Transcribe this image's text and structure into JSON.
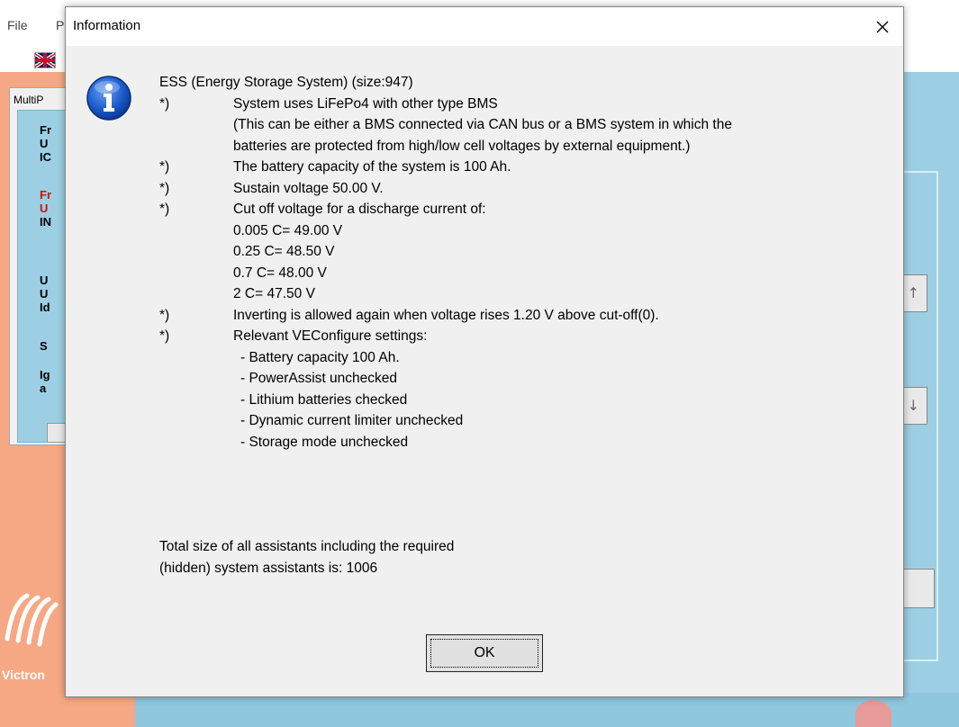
{
  "app": {
    "menu": {
      "file": "File",
      "second_partial": "P"
    },
    "multi_panel_title": "MultiP",
    "status_lines": [
      {
        "text": "Fr",
        "color": "#000000"
      },
      {
        "text": "U",
        "color": "#000000"
      },
      {
        "text": "IC",
        "color": "#000000"
      },
      {
        "text": "Fr",
        "color": "#d01010"
      },
      {
        "text": "U",
        "color": "#d01010"
      },
      {
        "text": "IN",
        "color": "#000000"
      },
      {
        "text": "U",
        "color": "#000000"
      },
      {
        "text": "U",
        "color": "#000000"
      },
      {
        "text": "Id",
        "color": "#000000"
      },
      {
        "text": "S",
        "color": "#000000"
      },
      {
        "text": "Ig",
        "color": "#000000"
      },
      {
        "text": "a",
        "color": "#000000"
      }
    ],
    "logo_text": "Victron",
    "colors": {
      "background_orange": "#f6a884",
      "panel_blue": "#9ccfe3"
    }
  },
  "dialog": {
    "title": "Information",
    "icon": "info-icon",
    "close_icon": "close-icon",
    "heading": "ESS (Energy Storage System) (size:947)",
    "lines": [
      {
        "bullet": "*)",
        "text": "System uses LiFePo4 with other type BMS"
      },
      {
        "bullet": "",
        "text": "(This can be either a BMS connected via CAN bus or a BMS system in which the"
      },
      {
        "bullet": "",
        "text": "batteries are protected from high/low cell voltages by external equipment.)"
      },
      {
        "bullet": "*)",
        "text": "The battery capacity of the system is 100 Ah."
      },
      {
        "bullet": "*)",
        "text": "Sustain voltage 50.00 V."
      },
      {
        "bullet": "*)",
        "text": "Cut off voltage for a discharge current of:"
      },
      {
        "bullet": "",
        "text": "0.005 C= 49.00 V"
      },
      {
        "bullet": "",
        "text": "0.25 C= 48.50 V"
      },
      {
        "bullet": "",
        "text": "0.7 C= 48.00 V"
      },
      {
        "bullet": "",
        "text": "2 C= 47.50 V"
      },
      {
        "bullet": "*)",
        "text": "Inverting is allowed again when voltage rises 1.20 V above cut-off(0)."
      },
      {
        "bullet": "*)",
        "text": "Relevant VEConfigure settings:"
      }
    ],
    "settings": [
      "- Battery capacity 100 Ah.",
      "- PowerAssist unchecked",
      "- Lithium batteries checked",
      "- Dynamic current limiter unchecked",
      "- Storage mode unchecked"
    ],
    "footer": [
      "Total size of all assistants including the required",
      "(hidden) system assistants is: 1006"
    ],
    "ok_label": "OK"
  }
}
